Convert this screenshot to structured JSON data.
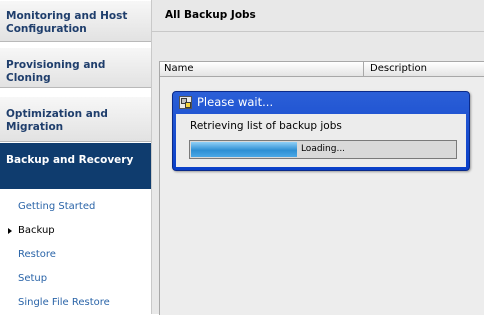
{
  "sidebar": {
    "sections": [
      {
        "label": "Monitoring and Host Configuration"
      },
      {
        "label": "Provisioning and Cloning"
      },
      {
        "label": "Optimization and Migration"
      },
      {
        "label": "Backup and Recovery"
      }
    ],
    "active_section": "Backup and Recovery",
    "items": [
      {
        "label": "Getting Started"
      },
      {
        "label": "Backup"
      },
      {
        "label": "Restore"
      },
      {
        "label": "Setup"
      },
      {
        "label": "Single File Restore"
      }
    ],
    "active_item": "Backup"
  },
  "main": {
    "title": "All Backup Jobs",
    "table": {
      "columns": [
        "Name",
        "Description"
      ]
    }
  },
  "dialog": {
    "title": "Please wait...",
    "message": "Retrieving list of backup jobs",
    "progress_text": "Loading...",
    "progress_fraction": 0.4,
    "icon": "wait-icon"
  },
  "colors": {
    "active_section_bg": "#0f3c6e",
    "link": "#2a64a8",
    "dialog_title_bg": "#0a3fc8",
    "progress_fill": "#2e8fd4"
  }
}
